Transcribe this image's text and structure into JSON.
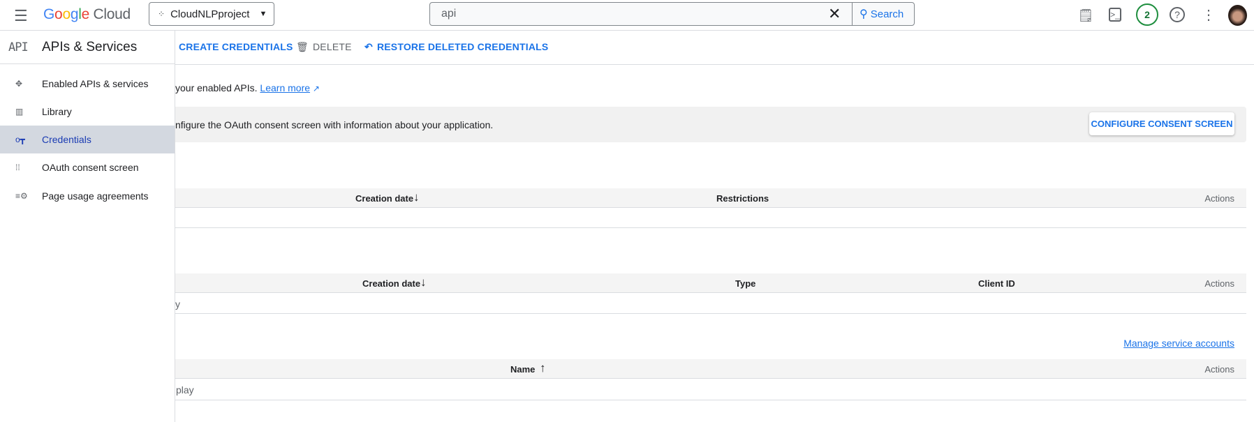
{
  "topbar": {
    "logo": "Google Cloud",
    "project": "CloudNLPproject",
    "search_value": "api",
    "search_button": "Search",
    "notifications_count": "2",
    "icons": [
      "hamburger-icon",
      "project-icon",
      "dropdown-icon",
      "clear-icon",
      "search-icon",
      "gemini-notes-icon",
      "cloud-shell-icon",
      "help-icon",
      "more-vert-icon",
      "avatar"
    ]
  },
  "sidebar": {
    "title": "APIs & Services",
    "items": [
      {
        "label": "Enabled APIs & services",
        "icon": "enabled-apis-icon"
      },
      {
        "label": "Library",
        "icon": "library-icon"
      },
      {
        "label": "Credentials",
        "icon": "key-icon",
        "active": true
      },
      {
        "label": "OAuth consent screen",
        "icon": "oauth-icon"
      },
      {
        "label": "Page usage agreements",
        "icon": "settings-list-icon"
      }
    ]
  },
  "toolbar": {
    "create": "CREATE CREDENTIALS",
    "delete": "DELETE",
    "restore": "RESTORE DELETED CREDENTIALS"
  },
  "main": {
    "intro": "your enabled APIs.",
    "learn_more": "Learn more",
    "banner_text": "nfigure the OAuth consent screen with information about your application.",
    "banner_button": "CONFIGURE CONSENT SCREEN",
    "api_keys_table": {
      "headers": [
        "Creation date",
        "Restrictions",
        "Actions"
      ]
    },
    "oauth_table": {
      "headers": [
        "Creation date",
        "Type",
        "Client ID",
        "Actions"
      ],
      "row_fragment": "y"
    },
    "manage_service_accounts": "Manage service accounts",
    "service_accounts_table": {
      "headers": [
        "Name",
        "Actions"
      ],
      "row_fragment": "play"
    }
  },
  "colors": {
    "accent": "#1a73e8",
    "active_bg": "#d3d8e0",
    "badge": "#188038"
  }
}
